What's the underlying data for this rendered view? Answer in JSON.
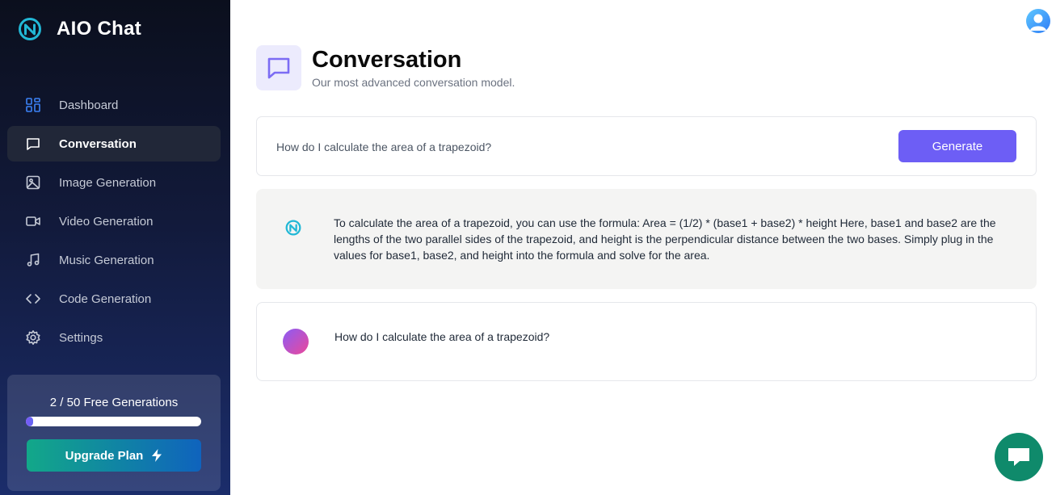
{
  "app": {
    "name": "AIO Chat"
  },
  "sidebar": {
    "items": [
      {
        "label": "Dashboard",
        "icon": "dashboard-icon"
      },
      {
        "label": "Conversation",
        "icon": "message-square-icon",
        "active": true
      },
      {
        "label": "Image Generation",
        "icon": "image-icon"
      },
      {
        "label": "Video Generation",
        "icon": "video-icon"
      },
      {
        "label": "Music Generation",
        "icon": "music-icon"
      },
      {
        "label": "Code Generation",
        "icon": "code-icon"
      },
      {
        "label": "Settings",
        "icon": "settings-icon"
      }
    ],
    "plan": {
      "text": "2 / 50 Free Generations",
      "used": 2,
      "total": 50,
      "upgrade_label": "Upgrade Plan"
    }
  },
  "header": {
    "title": "Conversation",
    "subtitle": "Our most advanced conversation model."
  },
  "prompt": {
    "value": "How do I calculate the area of a trapezoid?",
    "generate_label": "Generate"
  },
  "messages": [
    {
      "role": "bot",
      "text": "To calculate the area of a trapezoid, you can use the formula: Area = (1/2) * (base1 + base2) * height Here, base1 and base2 are the lengths of the two parallel sides of the trapezoid, and height is the perpendicular distance between the two bases. Simply plug in the values for base1, base2, and height into the formula and solve for the area."
    },
    {
      "role": "user",
      "text": "How do I calculate the area of a trapezoid?"
    }
  ],
  "colors": {
    "accent": "#6d5ef5",
    "brand_cyan": "#22b8d6",
    "chat_button": "#0f8a6b"
  }
}
